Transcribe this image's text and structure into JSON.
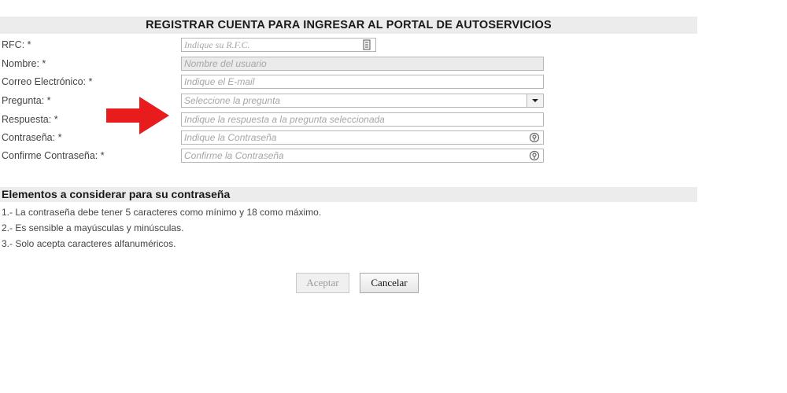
{
  "form": {
    "title": "REGISTRAR CUENTA PARA INGRESAR AL PORTAL DE AUTOSERVICIOS",
    "fields": {
      "rfc": {
        "label": "RFC: *",
        "placeholder": "Indique su R.F.C.",
        "value": ""
      },
      "nombre": {
        "label": "Nombre: *",
        "placeholder": "Nombre del usuario",
        "value": ""
      },
      "correo": {
        "label": "Correo Electrónico: *",
        "placeholder": "Indique el E-mail",
        "value": ""
      },
      "pregunta": {
        "label": "Pregunta: *",
        "placeholder": "Seleccione la pregunta",
        "selected": "Seleccione la pregunta"
      },
      "respuesta": {
        "label": "Respuesta: *",
        "placeholder": "Indique la respuesta a la pregunta seleccionada",
        "value": ""
      },
      "contrasena": {
        "label": "Contraseña: *",
        "placeholder": "Indique la Contraseña",
        "value": ""
      },
      "confirmar": {
        "label": "Confirme Contraseña: *",
        "placeholder": "Confirme la Contraseña",
        "value": ""
      }
    },
    "icons": {
      "rfc": "id-card-icon",
      "password": "eye-icon",
      "pointer": "red-arrow-icon"
    }
  },
  "rules": {
    "title": "Elementos a considerar para su contraseña",
    "items": [
      "1.- La contraseña debe tener 5 caracteres como mínimo y 18 como máximo.",
      "2.- Es sensible a mayúsculas y minúsculas.",
      "3.- Solo acepta caracteres alfanuméricos."
    ]
  },
  "actions": {
    "accept_label": "Aceptar",
    "cancel_label": "Cancelar"
  },
  "colors": {
    "header_bg": "#ececec",
    "arrow": "#e81c1c",
    "disabled_field": "#ebebeb"
  }
}
